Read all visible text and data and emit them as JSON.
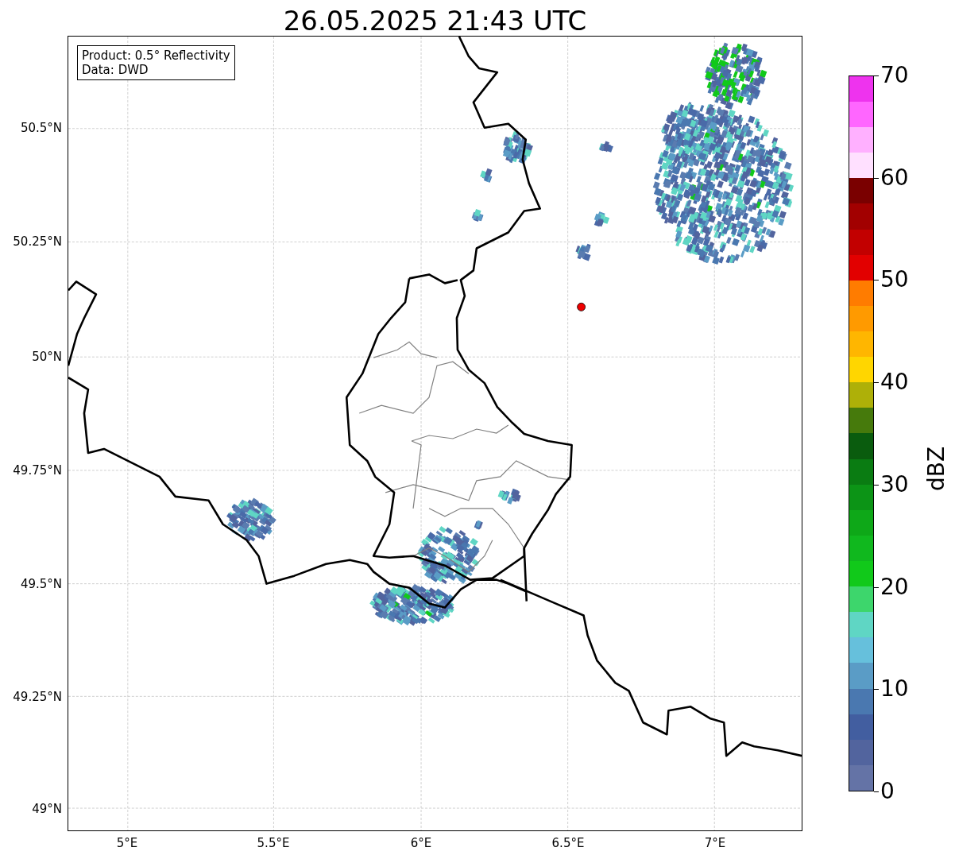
{
  "title": "26.05.2025 21:43 UTC",
  "info_box": [
    "Product: 0.5° Reflectivity",
    "Data: DWD"
  ],
  "y_ticks": [
    "50.5°N",
    "50.25°N",
    "50°N",
    "49.75°N",
    "49.5°N",
    "49.25°N",
    "49°N"
  ],
  "x_ticks": [
    "5°E",
    "5.5°E",
    "6°E",
    "6.5°E",
    "7°E"
  ],
  "colorbar": {
    "label": "dBZ",
    "ticks": [
      "70",
      "60",
      "50",
      "40",
      "30",
      "20",
      "10",
      "0"
    ],
    "bins": [
      {
        "color": "#6473a6"
      },
      {
        "color": "#52649e"
      },
      {
        "color": "#425ea0"
      },
      {
        "color": "#4a78b0"
      },
      {
        "color": "#5a9cc6"
      },
      {
        "color": "#66c0dc"
      },
      {
        "color": "#5fd6c4"
      },
      {
        "color": "#3dd66c"
      },
      {
        "color": "#11c91a"
      },
      {
        "color": "#10b81e"
      },
      {
        "color": "#0ea818"
      },
      {
        "color": "#0c9416"
      },
      {
        "color": "#0a7c12"
      },
      {
        "color": "#0a5c0e"
      },
      {
        "color": "#467a0c"
      },
      {
        "color": "#aeb008"
      },
      {
        "color": "#ffd600"
      },
      {
        "color": "#ffb600"
      },
      {
        "color": "#ff9a00"
      },
      {
        "color": "#ff7c00"
      },
      {
        "color": "#e20000"
      },
      {
        "color": "#c20000"
      },
      {
        "color": "#a20000"
      },
      {
        "color": "#7a0000"
      },
      {
        "color": "#ffe0ff"
      },
      {
        "color": "#ffb0ff"
      },
      {
        "color": "#ff66ff"
      },
      {
        "color": "#ee33ee"
      }
    ]
  }
}
